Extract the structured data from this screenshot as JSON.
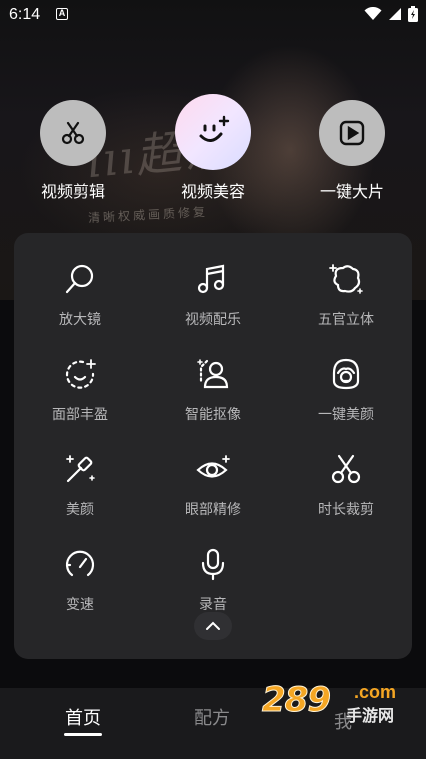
{
  "status_bar": {
    "time": "6:14",
    "notif_letter": "A"
  },
  "hero": {
    "script_text": "ııı超清",
    "subtitle": "清晰权威画质修复"
  },
  "features": [
    {
      "label": "视频剪辑",
      "icon": "scissors-icon"
    },
    {
      "label": "视频美容",
      "icon": "smile-sparkle-icon"
    },
    {
      "label": "一键大片",
      "icon": "play-square-icon"
    }
  ],
  "tools": [
    {
      "label": "放大镜",
      "icon": "magnifier-icon"
    },
    {
      "label": "视频配乐",
      "icon": "music-note-icon"
    },
    {
      "label": "五官立体",
      "icon": "face-3d-icon"
    },
    {
      "label": "面部丰盈",
      "icon": "face-fill-icon"
    },
    {
      "label": "智能抠像",
      "icon": "portrait-cutout-icon"
    },
    {
      "label": "一键美颜",
      "icon": "beauty-face-icon"
    },
    {
      "label": "美颜",
      "icon": "magic-wand-icon"
    },
    {
      "label": "眼部精修",
      "icon": "eye-sparkle-icon"
    },
    {
      "label": "时长裁剪",
      "icon": "scissors-icon"
    },
    {
      "label": "变速",
      "icon": "speedometer-icon"
    },
    {
      "label": "录音",
      "icon": "microphone-icon"
    }
  ],
  "bottom_nav": {
    "home": "首页",
    "recipe": "配方",
    "me": "我"
  },
  "watermark": {
    "number": "289",
    "domain": ".com",
    "text": "手游网"
  },
  "colors": {
    "panel": "#262628",
    "accent_watermark": "#f5a623",
    "text_muted": "#b7b7b9"
  }
}
